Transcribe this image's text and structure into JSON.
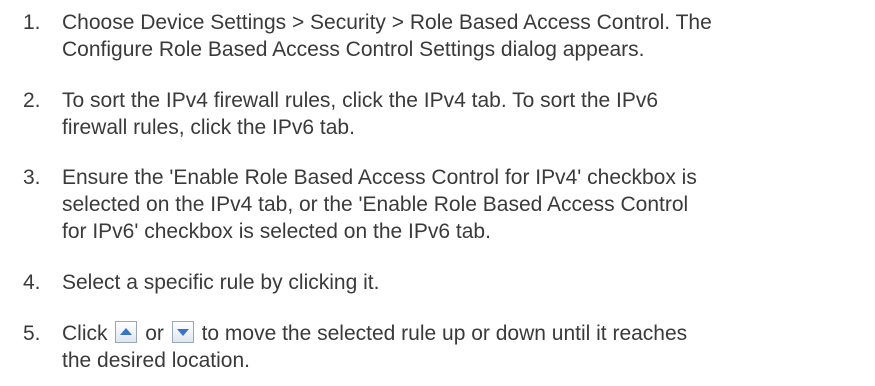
{
  "steps": [
    {
      "number": "1.",
      "lines": [
        "Choose Device Settings > Security > Role Based Access Control. The",
        "Configure Role Based Access Control Settings dialog appears."
      ]
    },
    {
      "number": "2.",
      "lines": [
        "To sort the IPv4 firewall rules, click the IPv4 tab. To sort the IPv6",
        "firewall rules, click the IPv6 tab."
      ]
    },
    {
      "number": "3.",
      "lines": [
        "Ensure the 'Enable Role Based Access Control for IPv4' checkbox is",
        "selected on the IPv4 tab, or the 'Enable Role Based Access Control",
        "for IPv6' checkbox is selected on the IPv6 tab."
      ]
    },
    {
      "number": "4.",
      "lines": [
        "Select a specific rule by clicking it."
      ]
    },
    {
      "number": "5.",
      "click_text": "Click",
      "or_text": "or",
      "rest_line1": "to move the selected rule up or down until it reaches",
      "line2": "the desired location.",
      "up_icon": "move-up-icon",
      "down_icon": "move-down-icon"
    }
  ],
  "colors": {
    "text": "#3a3a3a",
    "icon_arrow": "#3b73c4"
  }
}
